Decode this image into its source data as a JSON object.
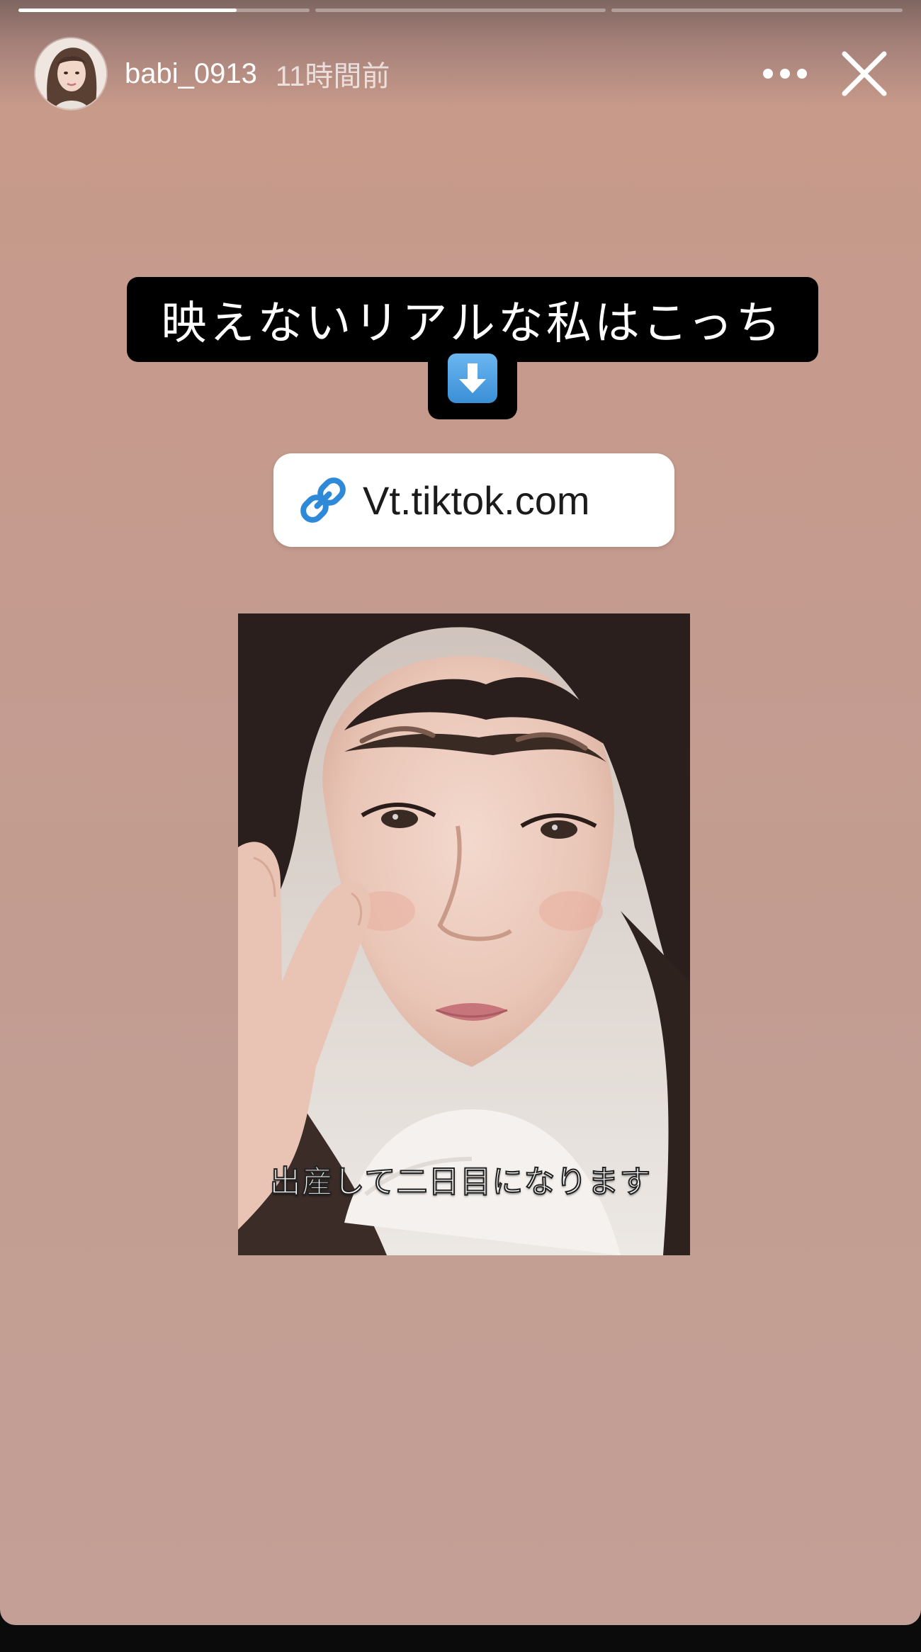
{
  "story": {
    "progress": {
      "segments": [
        {
          "fraction": 0.75
        },
        {
          "fraction": 0
        },
        {
          "fraction": 0
        }
      ]
    },
    "header": {
      "username": "babi_0913",
      "timestamp": "11時間前",
      "more_icon": "more-horizontal-icon",
      "close_icon": "close-icon"
    },
    "caption": {
      "text": "映えないリアルな私はこっち",
      "emoji": "down-arrow-emoji"
    },
    "link_sticker": {
      "icon": "link-icon",
      "text": "Vt.tiktok.com"
    },
    "photo": {
      "subtitle": "出産して二日目になります"
    }
  },
  "colors": {
    "background": "#c49b8f",
    "link_icon": "#2e8ad8",
    "caption_bg": "#000000"
  }
}
